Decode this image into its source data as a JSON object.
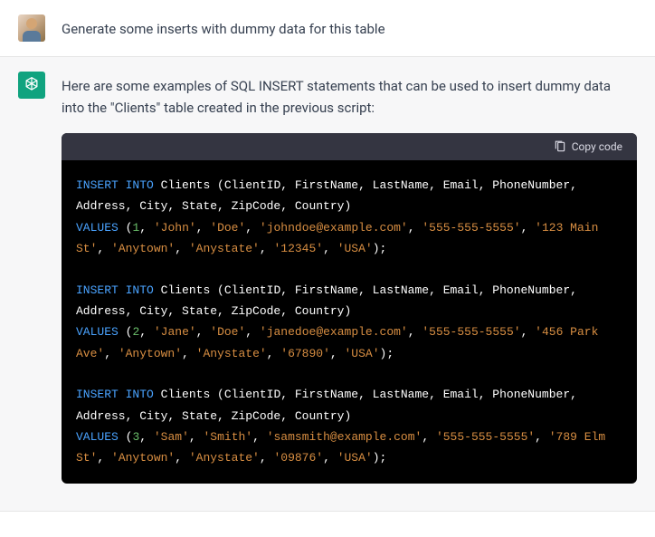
{
  "user_message": "Generate some inserts with dummy data for this table",
  "assistant_intro": "Here are some examples of SQL INSERT statements that can be used to insert dummy data into the \"Clients\" table created in the previous script:",
  "copy_label": "Copy code",
  "sql": {
    "columns": "Clients (ClientID, FirstName, LastName, Email, PhoneNumber, Address, City, State, ZipCode, Country)",
    "insert_into": "INSERT INTO",
    "values_kw": "VALUES",
    "rows": [
      {
        "id": "1",
        "first": "'John'",
        "last": "'Doe'",
        "email": "'johndoe@example.com'",
        "phone": "'555-555-5555'",
        "addr": "'123 Main St'",
        "city": "'Anytown'",
        "state": "'Anystate'",
        "zip": "'12345'",
        "country": "'USA'"
      },
      {
        "id": "2",
        "first": "'Jane'",
        "last": "'Doe'",
        "email": "'janedoe@example.com'",
        "phone": "'555-555-5555'",
        "addr": "'456 Park Ave'",
        "city": "'Anytown'",
        "state": "'Anystate'",
        "zip": "'67890'",
        "country": "'USA'"
      },
      {
        "id": "3",
        "first": "'Sam'",
        "last": "'Smith'",
        "email": "'samsmith@example.com'",
        "phone": "'555-555-5555'",
        "addr": "'789 Elm St'",
        "city": "'Anytown'",
        "state": "'Anystate'",
        "zip": "'09876'",
        "country": "'USA'"
      }
    ]
  }
}
